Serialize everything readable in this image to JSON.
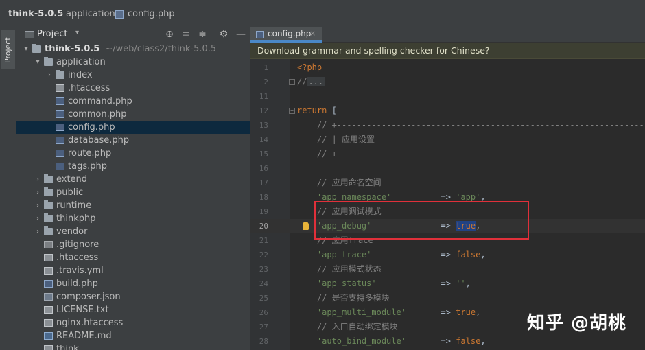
{
  "breadcrumb": {
    "root": "think-5.0.5",
    "separator": "›",
    "folder": "application",
    "file": "config.php"
  },
  "left_strip": {
    "tab_label": "Project"
  },
  "project_panel": {
    "title": "Project",
    "caret": "▾",
    "tools": {
      "locate": "⊕",
      "expand": "≡",
      "collapse": "≑",
      "settings": "⚙",
      "hide": "—"
    },
    "tree": [
      {
        "arrow": "▾",
        "label": "think-5.0.5",
        "path": "~/web/class2/think-5.0.5",
        "icon": "folder"
      },
      {
        "arrow": "▾",
        "label": "application",
        "icon": "folder"
      },
      {
        "arrow": "›",
        "label": "index",
        "icon": "folder"
      },
      {
        "arrow": "",
        "label": ".htaccess",
        "icon": "file"
      },
      {
        "arrow": "",
        "label": "command.php",
        "icon": "php"
      },
      {
        "arrow": "",
        "label": "common.php",
        "icon": "php"
      },
      {
        "arrow": "",
        "label": "config.php",
        "icon": "php",
        "selected": true
      },
      {
        "arrow": "",
        "label": "database.php",
        "icon": "php"
      },
      {
        "arrow": "",
        "label": "route.php",
        "icon": "php"
      },
      {
        "arrow": "",
        "label": "tags.php",
        "icon": "php"
      },
      {
        "arrow": "›",
        "label": "extend",
        "icon": "folder"
      },
      {
        "arrow": "›",
        "label": "public",
        "icon": "folder"
      },
      {
        "arrow": "›",
        "label": "runtime",
        "icon": "folder"
      },
      {
        "arrow": "›",
        "label": "thinkphp",
        "icon": "folder"
      },
      {
        "arrow": "›",
        "label": "vendor",
        "icon": "folder"
      },
      {
        "arrow": "",
        "label": ".gitignore",
        "icon": "git"
      },
      {
        "arrow": "",
        "label": ".htaccess",
        "icon": "file"
      },
      {
        "arrow": "",
        "label": ".travis.yml",
        "icon": "file"
      },
      {
        "arrow": "",
        "label": "build.php",
        "icon": "php"
      },
      {
        "arrow": "",
        "label": "composer.json",
        "icon": "json"
      },
      {
        "arrow": "",
        "label": "LICENSE.txt",
        "icon": "txt"
      },
      {
        "arrow": "",
        "label": "nginx.htaccess",
        "icon": "file"
      },
      {
        "arrow": "",
        "label": "README.md",
        "icon": "md"
      },
      {
        "arrow": "",
        "label": "think",
        "icon": "file"
      }
    ]
  },
  "editor": {
    "tab": {
      "label": "config.php",
      "close": "×"
    },
    "banner": "Download grammar and spelling checker for Chinese?",
    "lines": [
      {
        "n": "1",
        "html": "<span class=\"kw\">&lt;?php</span>"
      },
      {
        "n": "2",
        "html": "<span class=\"cmt\">//</span><span class=\"fold-region\">...</span>"
      },
      {
        "n": "11",
        "html": ""
      },
      {
        "n": "12",
        "html": "<span class=\"kw\">return</span> ["
      },
      {
        "n": "13",
        "html": "    <span class=\"cmt\">// +----------------------------------------------------------------</span>"
      },
      {
        "n": "14",
        "html": "    <span class=\"cmt\">// | 应用设置</span>"
      },
      {
        "n": "15",
        "html": "    <span class=\"cmt\">// +----------------------------------------------------------------</span>"
      },
      {
        "n": "16",
        "html": ""
      },
      {
        "n": "17",
        "html": "    <span class=\"cmt\">// 应用命名空间</span>"
      },
      {
        "n": "18",
        "html": "    <span class=\"str\">'app_namespace'</span>          =&gt; <span class=\"str\">'app'</span>,"
      },
      {
        "n": "19",
        "html": "    <span class=\"cmt\">// 应用调试模式</span>"
      },
      {
        "n": "20",
        "html": "    <span class=\"str\">'app_debug'</span>              =&gt; <span class=\"kw hl-true\">true</span>,",
        "current": true
      },
      {
        "n": "21",
        "html": "    <span class=\"cmt\">// 应用Trace</span>"
      },
      {
        "n": "22",
        "html": "    <span class=\"str\">'app_trace'</span>              =&gt; <span class=\"kw\">false</span>,"
      },
      {
        "n": "23",
        "html": "    <span class=\"cmt\">// 应用模式状态</span>"
      },
      {
        "n": "24",
        "html": "    <span class=\"str\">'app_status'</span>             =&gt; <span class=\"str\">''</span>,"
      },
      {
        "n": "25",
        "html": "    <span class=\"cmt\">// 是否支持多模块</span>"
      },
      {
        "n": "26",
        "html": "    <span class=\"str\">'app_multi_module'</span>       =&gt; <span class=\"kw\">true</span>,"
      },
      {
        "n": "27",
        "html": "    <span class=\"cmt\">// 入口自动绑定模块</span>"
      },
      {
        "n": "28",
        "html": "    <span class=\"str\">'auto_bind_module'</span>       =&gt; <span class=\"kw\">false</span>,"
      }
    ]
  },
  "watermark": "知乎 @胡桃",
  "colors": {
    "selection": "#0d293e",
    "keyword": "#cc7832",
    "string": "#6a8759",
    "comment": "#808080",
    "annotation_box": "#e0303a"
  }
}
